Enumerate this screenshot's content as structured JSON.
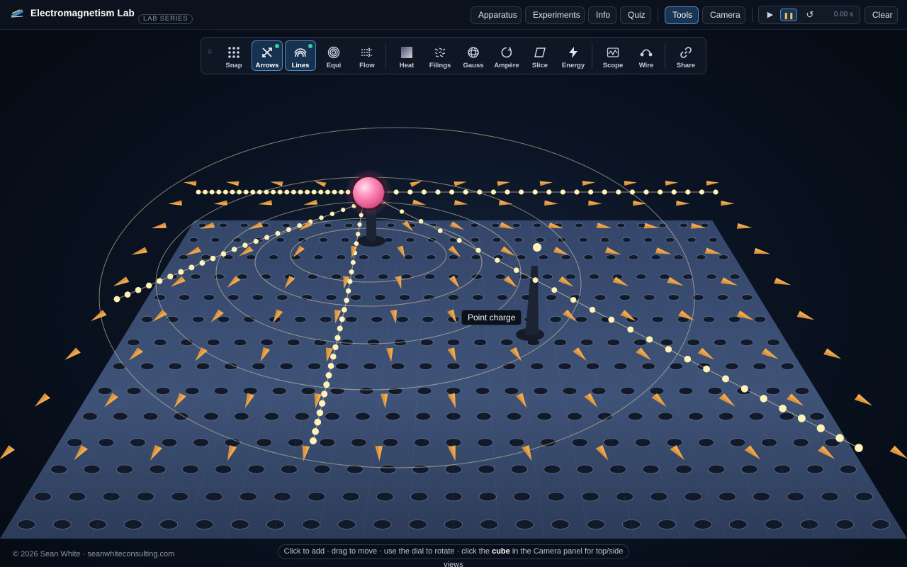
{
  "header": {
    "title": "Electromagnetism Lab",
    "badge": "LAB SERIES",
    "nav": [
      "Apparatus",
      "Experiments",
      "Info",
      "Quiz"
    ],
    "view": [
      "Tools",
      "Camera"
    ],
    "active_view": "Tools",
    "time": "0.00 s",
    "clear": "Clear"
  },
  "toolbar": {
    "tools": [
      {
        "label": "Snap",
        "icon": "grid-dots-icon",
        "active": false
      },
      {
        "label": "Arrows",
        "icon": "arrows-icon",
        "active": true
      },
      {
        "label": "Lines",
        "icon": "field-lines-icon",
        "active": true
      },
      {
        "label": "Equi",
        "icon": "equipotential-rings-icon",
        "active": false
      },
      {
        "label": "Flow",
        "icon": "flow-arrows-icon",
        "active": false
      },
      {
        "label": "Heat",
        "icon": "heatmap-icon",
        "active": false
      },
      {
        "label": "Filings",
        "icon": "filings-icon",
        "active": false
      },
      {
        "label": "Gauss",
        "icon": "gauss-sphere-icon",
        "active": false
      },
      {
        "label": "Ampère",
        "icon": "ampere-loop-icon",
        "active": false
      },
      {
        "label": "Slice",
        "icon": "slice-plane-icon",
        "active": false
      },
      {
        "label": "Energy",
        "icon": "lightning-icon",
        "active": false
      },
      {
        "label": "Scope",
        "icon": "oscilloscope-icon",
        "active": false
      },
      {
        "label": "Wire",
        "icon": "wire-icon",
        "active": false
      },
      {
        "label": "Share",
        "icon": "link-icon",
        "active": false
      }
    ]
  },
  "scene": {
    "tooltip": "Point charge",
    "colors": {
      "charge": "#ff7fae",
      "arrows": "#f2a94a",
      "field_line_dots": "#fff2b8",
      "board": "#3b4d6e"
    }
  },
  "footer": {
    "copyright": "© 2026 Sean White · seanwhiteconsulting.com",
    "hint_before": "Click to add · drag to move · use the dial to rotate · click the ",
    "hint_bold": "cube",
    "hint_after": " in the Camera panel for top/side views"
  }
}
